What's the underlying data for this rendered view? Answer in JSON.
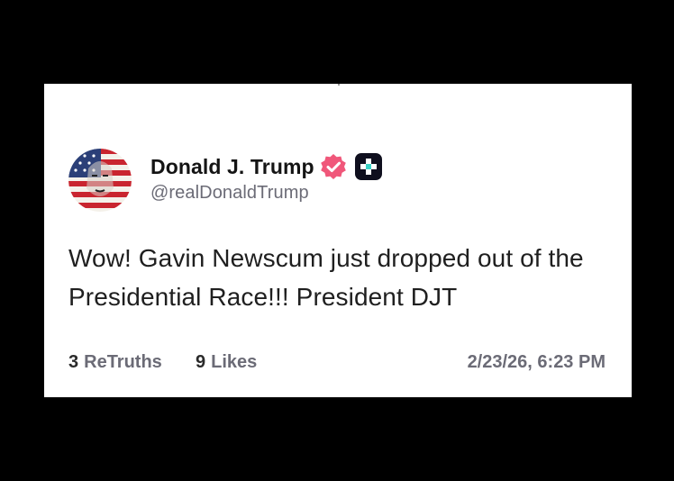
{
  "post": {
    "author": {
      "display_name": "Donald J. Trump",
      "handle": "@realDonaldTrump",
      "verified_icon": "verified-badge-icon",
      "plus_icon": "truth-plus-icon"
    },
    "text": "Wow! Gavin Newscum just dropped out of the Presidential Race!!! President DJT",
    "stats": {
      "retruths_count": "3",
      "retruths_label": "ReTruths",
      "likes_count": "9",
      "likes_label": "Likes"
    },
    "timestamp": "2/23/26, 6:23 PM"
  },
  "colors": {
    "background": "#000000",
    "card": "#ffffff",
    "verified_badge": "#f0577a",
    "plus_badge": "#0f0f1e",
    "muted_text": "#6b6b76"
  }
}
